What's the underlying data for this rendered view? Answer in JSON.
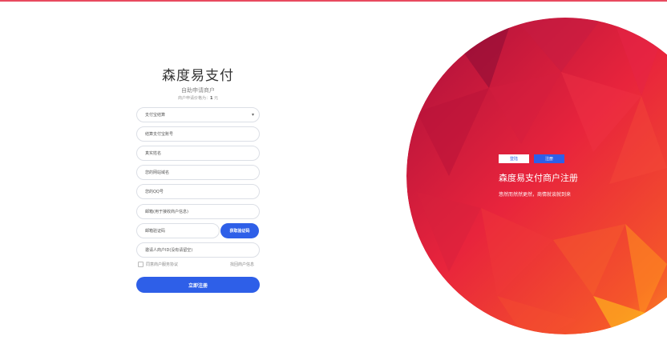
{
  "brand": "森度易支付",
  "subtitle": "自助申请商户",
  "price_prefix": "商户申请价格为：",
  "price_value": "1",
  "price_suffix": " 元",
  "fields": {
    "settlement_type": "支付宝结算",
    "settlement_account": "结算支付宝账号",
    "real_name": "真实姓名",
    "website_domain": "您的网站域名",
    "qq": "您的QQ号",
    "email": "邮箱(用于接收商户信息)",
    "email_code": "邮箱验证码",
    "inviter": "邀请人商户ID(没有请留空)"
  },
  "get_code": "获取验证码",
  "agreement": "同意商户服务协议",
  "retrieve": "找回商户信息",
  "submit": "立即注册",
  "hero": {
    "login_tab": "登陆",
    "register_tab": "注册",
    "title": "森度易支付商户注册",
    "desc": "悠然而然然更然，商情就谈就到来"
  },
  "colors": {
    "accent": "#2e5fe8",
    "hero_red": "#e8243c",
    "hero_orange": "#ff8c1a",
    "hero_dark": "#a80f3c"
  }
}
